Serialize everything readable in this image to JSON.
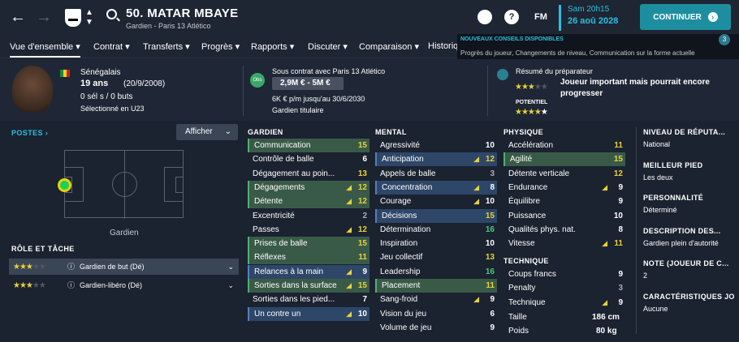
{
  "header": {
    "player_name": "50. MATAR MBAYE",
    "player_sub": "Gardien - Paris 13 Atlético",
    "fm": "FM",
    "date_day": "Sam 20h15",
    "date_full": "26 aoû 2028",
    "continue": "CONTINUER"
  },
  "tabs": [
    "Vue d'ensemble ▾",
    "Contrat ▾",
    "Transferts ▾",
    "Progrès ▾",
    "Rapports ▾",
    "Discuter ▾",
    "Comparaison ▾",
    "Historiq"
  ],
  "notification": {
    "title": "NOUVEAUX CONSEILS DISPONIBLES",
    "text": "Progrès du joueur, Changements de niveau, Communication sur la forme actuelle",
    "count": "3"
  },
  "info": {
    "nationality": "Sénégalais",
    "age": "19 ans",
    "dob": "(20/9/2008)",
    "goals": "0 sél s / 0 buts",
    "u23": "Sélectionné en U23",
    "contract": "Sous contrat avec Paris 13 Atlético",
    "value": "2,9M € - 5M €",
    "wage": "6K € p/m jusqu'au 30/6/2030",
    "status": "Gardien titulaire",
    "obs": "Obs",
    "scout_title": "Résumé du préparateur",
    "scout_text": "Joueur important mais pourrait encore progresser",
    "potential": "POTENTIEL"
  },
  "left": {
    "postes": "POSTES ›",
    "afficher": "Afficher",
    "position_label": "Gardien",
    "role_title": "RÔLE ET TÂCHE",
    "roles": [
      "Gardien de but (Dé)",
      "Gardien-libéro (Dé)"
    ]
  },
  "sections": {
    "gardien": "GARDIEN",
    "mental": "MENTAL",
    "physique": "PHYSIQUE",
    "technique": "TECHNIQUE"
  },
  "gardien": [
    [
      "Communication",
      "15",
      "g",
      ""
    ],
    [
      "Contrôle de balle",
      "6",
      "",
      ""
    ],
    [
      "Dégagement au poin...",
      "13",
      "",
      ""
    ],
    [
      "Dégagements",
      "12",
      "g",
      "▲"
    ],
    [
      "Détente",
      "12",
      "g",
      "▲"
    ],
    [
      "Excentricité",
      "2",
      "",
      ""
    ],
    [
      "Passes",
      "12",
      "",
      "▲"
    ],
    [
      "Prises de balle",
      "15",
      "g",
      ""
    ],
    [
      "Réflexes",
      "11",
      "g",
      ""
    ],
    [
      "Relances à la main",
      "9",
      "b",
      "▲"
    ],
    [
      "Sorties dans la surface",
      "15",
      "g",
      "▲"
    ],
    [
      "Sorties dans les pied...",
      "7",
      "",
      ""
    ],
    [
      "Un contre un",
      "10",
      "b",
      "▲"
    ]
  ],
  "mental": [
    [
      "Agressivité",
      "10",
      "",
      ""
    ],
    [
      "Anticipation",
      "12",
      "b",
      "▲"
    ],
    [
      "Appels de balle",
      "3",
      "",
      ""
    ],
    [
      "Concentration",
      "8",
      "b",
      "▲"
    ],
    [
      "Courage",
      "10",
      "",
      "▲"
    ],
    [
      "Décisions",
      "15",
      "b",
      ""
    ],
    [
      "Détermination",
      "16",
      "",
      ""
    ],
    [
      "Inspiration",
      "10",
      "",
      ""
    ],
    [
      "Jeu collectif",
      "13",
      "",
      ""
    ],
    [
      "Leadership",
      "16",
      "",
      ""
    ],
    [
      "Placement",
      "11",
      "g",
      ""
    ],
    [
      "Sang-froid",
      "9",
      "",
      "▲"
    ],
    [
      "Vision du jeu",
      "6",
      "",
      ""
    ],
    [
      "Volume de jeu",
      "9",
      "",
      ""
    ]
  ],
  "physique": [
    [
      "Accélération",
      "11",
      "",
      ""
    ],
    [
      "Agilité",
      "15",
      "g",
      ""
    ],
    [
      "Détente verticale",
      "12",
      "",
      ""
    ],
    [
      "Endurance",
      "9",
      "",
      "▲"
    ],
    [
      "Équilibre",
      "9",
      "",
      ""
    ],
    [
      "Puissance",
      "10",
      "",
      ""
    ],
    [
      "Qualités phys. nat.",
      "8",
      "",
      ""
    ],
    [
      "Vitesse",
      "11",
      "",
      "▲"
    ]
  ],
  "technique": [
    [
      "Coups francs",
      "9",
      "",
      ""
    ],
    [
      "Penalty",
      "3",
      "",
      ""
    ],
    [
      "Technique",
      "9",
      "",
      "▲"
    ]
  ],
  "physical": {
    "height_label": "Taille",
    "height": "186 cm",
    "weight_label": "Poids",
    "weight": "80 kg"
  },
  "right": [
    [
      "NIVEAU DE RÉPUTA...",
      "National"
    ],
    [
      "MEILLEUR PIED",
      "Les deux"
    ],
    [
      "PERSONNALITÉ",
      "Déterminé"
    ],
    [
      "DESCRIPTION DES...",
      "Gardien plein d'autorité"
    ],
    [
      "NOTE (JOUEUR DE C...",
      "2"
    ],
    [
      "CARACTÉRISTIQUES JO",
      "Aucune"
    ]
  ]
}
